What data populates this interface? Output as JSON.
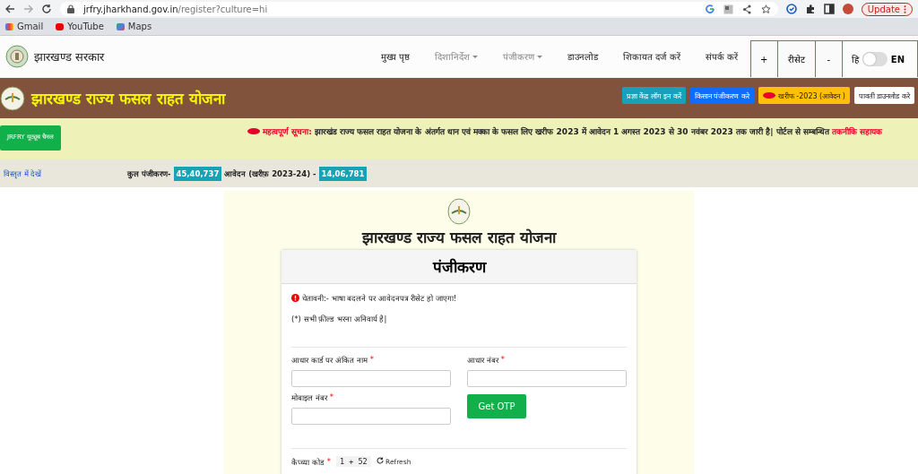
{
  "browser": {
    "url_host": "jrfry.jharkhand.gov.in",
    "url_path": "/register?culture=hi",
    "bookmarks": [
      "Gmail",
      "YouTube",
      "Maps"
    ],
    "update_button": "Update"
  },
  "header": {
    "site_name": "झारखण्ड सरकार",
    "nav": [
      {
        "label": "मुख्य पृष्ठ",
        "dropdown": false
      },
      {
        "label": "दिशानिर्देश",
        "dropdown": true
      },
      {
        "label": "पंजीकरण",
        "dropdown": true
      },
      {
        "label": "डाउनलोड",
        "dropdown": false
      },
      {
        "label": "शिकायत दर्ज करें",
        "dropdown": false
      },
      {
        "label": "संपर्क करें",
        "dropdown": false
      }
    ],
    "font_controls": [
      "+",
      "रीसेट",
      "-"
    ],
    "language": {
      "left": "हि",
      "right": "EN",
      "on": false
    }
  },
  "banner": {
    "title": "झारखण्ड राज्य फसल राहत योजना",
    "buttons": [
      {
        "label": "प्रज्ञा केंद्र लॉग इन करें",
        "kind": "info",
        "new_badge": false
      },
      {
        "label": "किसान पंजीकरण करे",
        "kind": "primary",
        "new_badge": false
      },
      {
        "label": "खरीफ -2023 (आवेदन )",
        "kind": "warning",
        "new_badge": true
      },
      {
        "label": "पावती डाउनलोड करे",
        "kind": "light",
        "new_badge": false
      }
    ]
  },
  "notice": {
    "side_button": "JRFRY यूट्यूब चैनल",
    "label": "महत्वपूर्ण सूचना:",
    "text": "झारखंड राज्य फसल राहत योजना के अंतर्गत धान एवं मक्का के फसल लिए खरीफ 2023 में आवेदन 1 अगस्त 2023 से 30 नवंबर 2023 तक जारी है| पोर्टल से सम्बन्धित",
    "link": "तकनीकि सहायक"
  },
  "stats": {
    "link": "विस्तृत में देखें",
    "total_label": "कुल पंजीकरण-",
    "total_value": "45,40,737",
    "applications_label": "आवेदन (खरीफ़ 2023-24) -",
    "applications_value": "14,06,781"
  },
  "form": {
    "title": "झारखण्ड राज्य फसल राहत योजना",
    "card_title": "पंजीकरण",
    "warning": "चेतावनी:- भाषा बदलने पर आवेदनपत्र रीसेट हो जाएगा!",
    "required_note": "(*) सभी फ़ील्ड भरना अनिवार्य है|",
    "fields": [
      {
        "label": "आधार कार्ड पर अंकित नाम",
        "required_mark": "*"
      },
      {
        "label": "आधार नंबर",
        "required_mark": "*"
      },
      {
        "label": "मोबाइल नंबर",
        "required_mark": "*"
      }
    ],
    "otp_button": "Get OTP",
    "captcha": {
      "label": "कैप्च्या कोड",
      "required_mark": "*",
      "code": "1 + 52",
      "refresh": "Refresh"
    }
  }
}
